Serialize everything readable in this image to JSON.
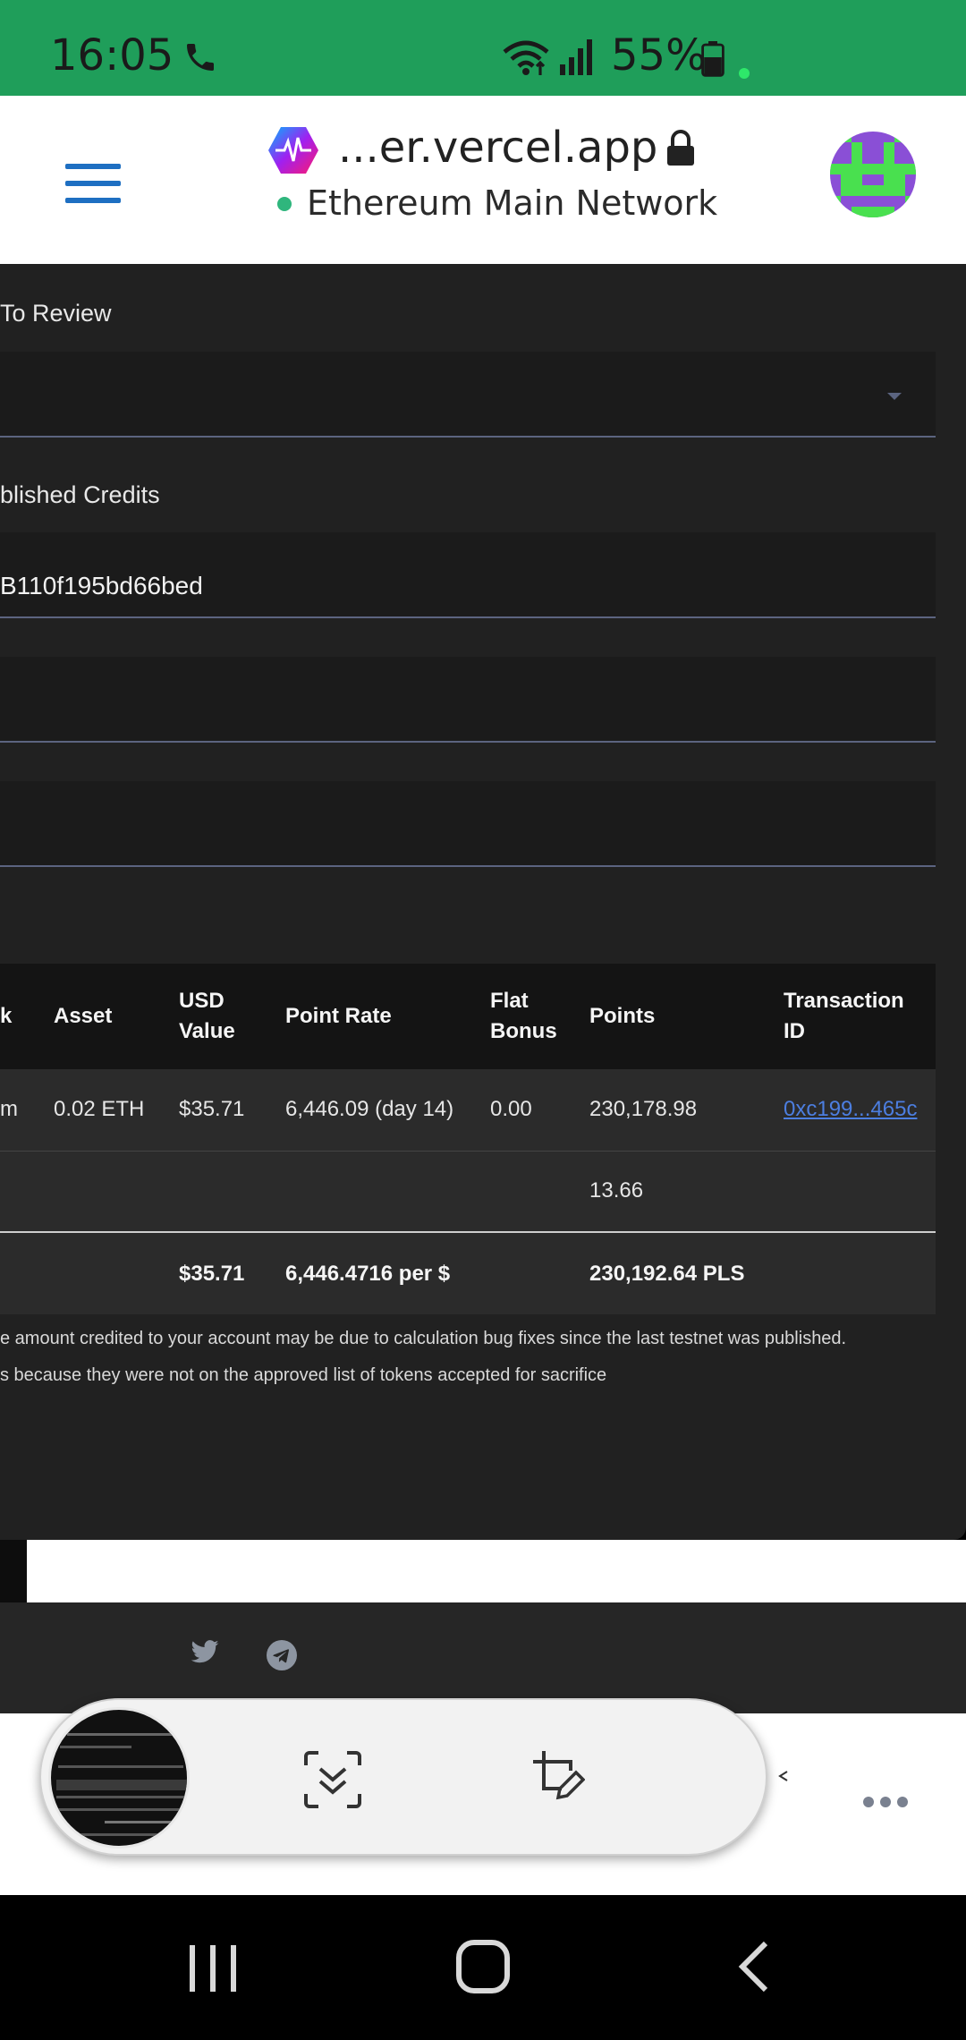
{
  "status_bar": {
    "time": "16:05",
    "battery": "55%",
    "icons": [
      "call-icon",
      "wifi-icon",
      "signal-icon",
      "battery-icon"
    ]
  },
  "browser": {
    "url": "...er.vercel.app",
    "network": "Ethereum Main Network",
    "network_status_color": "#2fb67d",
    "icons": [
      "menu-icon",
      "site-icon",
      "lock-icon",
      "account-avatar"
    ]
  },
  "form": {
    "review_label": "To Review",
    "review_select_value": "",
    "credits_label": "blished Credits",
    "address_value": "B110f195bd66bed",
    "field3_value": "",
    "field4_value": ""
  },
  "table": {
    "headers": [
      "k",
      "Asset",
      "USD Value",
      "Point Rate",
      "Flat Bonus",
      "Points",
      "Transaction ID"
    ],
    "rows": [
      [
        "m",
        "0.02 ETH",
        "$35.71",
        "6,446.09 (day 14)",
        "0.00",
        "230,178.98",
        "0xc199...465c"
      ],
      [
        "",
        "",
        "",
        "",
        "",
        "13.66",
        ""
      ]
    ],
    "totals": [
      "",
      "",
      "$35.71",
      "6,446.4716 per $",
      "",
      "230,192.64 PLS",
      ""
    ]
  },
  "notes": {
    "line1": "e amount credited to your account may be due to calculation bug fixes since the last testnet was published.",
    "line2": "s because they were not on the approved list of tokens accepted for sacrifice"
  },
  "footer": {
    "icons": [
      "twitter-icon",
      "telegram-icon"
    ]
  },
  "capture_toolbar": {
    "icons": [
      "screenshot-thumbnail",
      "scroll-capture-icon",
      "crop-edit-icon"
    ]
  },
  "colors": {
    "status_bar": "#1f9e5a",
    "accent": "#1e6fc2",
    "content_bg": "#212121",
    "link": "#4c7ee0"
  }
}
